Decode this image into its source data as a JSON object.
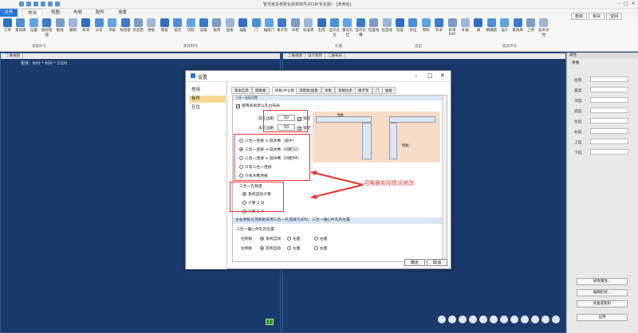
{
  "window": {
    "title": "智式家具参数化拆单软件2018(专业版) - [未命名]"
  },
  "menu": {
    "file": "文件",
    "tabs": [
      "常用",
      "视图",
      "布局",
      "配件",
      "场景"
    ]
  },
  "ribbon": {
    "buttons": [
      "订单",
      "家具库",
      "设置",
      "板材管理",
      "框线",
      "撤销",
      "拆单",
      "分享",
      "单板",
      "拆后板",
      "拆后柜",
      "拼板",
      "重复",
      "组合",
      "切割",
      "层板",
      "板阵",
      "固板",
      "插板",
      "门",
      "抽屉门",
      "格子架",
      "吊柜",
      "标准库",
      "生成",
      "显示孔位",
      "重设孔位",
      "显示孔槽",
      "拉直线",
      "拉直线",
      "检查",
      "导出",
      "物料",
      "料单",
      "拆单DXF",
      "补板",
      "填",
      "精确图",
      "设计",
      "家具库",
      "上传",
      "技术文档"
    ],
    "groups": [
      "基础命令",
      "家具制作",
      "孔槽",
      "造型",
      "家具平台"
    ]
  },
  "viewports": {
    "left_tab": "二维视图",
    "left_label": "柜体：600 * 600 * 2100",
    "right_tabs": [
      "二维视图",
      "设计矩阵",
      "二维布局"
    ]
  },
  "props": {
    "panel_title": "属性",
    "section": "参数",
    "tabs": [
      "柜体",
      "板块",
      "空间"
    ],
    "fields": [
      "名称",
      "宽度",
      "深度",
      "高度",
      "左延",
      "右延",
      "上延",
      "下延"
    ],
    "buttons": [
      "修改属性...",
      "编辑形状...",
      "恢复成矩形",
      "应用"
    ]
  },
  "dialog": {
    "title": "设置",
    "left_items": [
      "常用",
      "板件",
      "孔位"
    ],
    "tabs": [
      "基本信息",
      "圆板板",
      "侧板/中立板",
      "顶底板/层板",
      "背板",
      "背板拉条",
      "格子架",
      "门",
      "抽屉"
    ],
    "cut_header": "三合一连接设置",
    "use_default": "使用系统默认孔位布局",
    "front_label": "前孔边距:",
    "back_label": "末孔边距:",
    "front_value": "50",
    "back_value": "50",
    "lock": "锁定",
    "diagram_labels": [
      "顶板",
      "侧板"
    ],
    "options": [
      "三合一连接 + 圆木榫（居中）",
      "三合一连接 + 圆木榫（间距32）",
      "三合一连接 + 圆木榫（间距64）",
      "只有三合一连接",
      "只有木榫连接"
    ],
    "count_title": "三合一孔数量",
    "count_options": [
      "系统自动计算",
      "只要 2 对",
      "只要 1 个"
    ],
    "band1": "左右侧板与顶底板采用三合一孔连接方式时，三合一偏心件孔的位置",
    "pos_title": "三合一偏心件孔的位置",
    "left_label": "左侧板",
    "right_label": "右侧板",
    "pos_options": [
      "系统自动",
      "左面",
      "右面"
    ],
    "ok": "确定",
    "cancel": "取消"
  },
  "annotation": {
    "text": "可根据实际情况修改",
    "color": "#e8332e"
  },
  "colors": {
    "accent": "#2b78d0",
    "viewport": "#1a3a6b"
  }
}
